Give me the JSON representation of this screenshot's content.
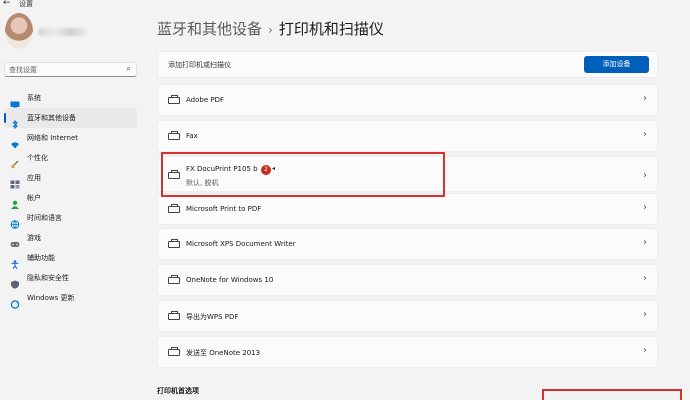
{
  "window": {
    "back_glyph": "←",
    "title": "设置"
  },
  "user": {
    "avatar": "avatar-photo"
  },
  "search": {
    "placeholder": "查找设置",
    "icon": "search-icon"
  },
  "sidebar": {
    "items": [
      {
        "label": "系统",
        "icon": "monitor-icon",
        "color": "#0078d4",
        "active": false
      },
      {
        "label": "蓝牙和其他设备",
        "icon": "bluetooth-icon",
        "color": "#0078d4",
        "active": true
      },
      {
        "label": "网络和 Internet",
        "icon": "wifi-icon",
        "color": "#0078d4",
        "active": false
      },
      {
        "label": "个性化",
        "icon": "brush-icon",
        "color": "#e3a33b",
        "active": false
      },
      {
        "label": "应用",
        "icon": "apps-icon",
        "color": "#5a6b7c",
        "active": false
      },
      {
        "label": "帐户",
        "icon": "account-icon",
        "color": "#2ea043",
        "active": false
      },
      {
        "label": "时间和语言",
        "icon": "globe-icon",
        "color": "#0078d4",
        "active": false
      },
      {
        "label": "游戏",
        "icon": "gamepad-icon",
        "color": "#6b6b6b",
        "active": false
      },
      {
        "label": "辅助功能",
        "icon": "accessibility-icon",
        "color": "#1f6fd1",
        "active": false
      },
      {
        "label": "隐私和安全性",
        "icon": "shield-icon",
        "color": "#5c6670",
        "active": false
      },
      {
        "label": "Windows 更新",
        "icon": "update-icon",
        "color": "#0078d4",
        "active": false
      }
    ]
  },
  "breadcrumb": {
    "parent": "蓝牙和其他设备",
    "separator": "›",
    "current": "打印机和扫描仪"
  },
  "add_device": {
    "label": "添加打印机或扫描仪",
    "button": "添加设备"
  },
  "printers": [
    {
      "name": "Adobe PDF",
      "status": ""
    },
    {
      "name": "Fax",
      "status": ""
    },
    {
      "name": "FX DocuPrint P105 b",
      "status": "默认, 脱机",
      "badge": "2"
    },
    {
      "name": "Microsoft Print to PDF",
      "status": ""
    },
    {
      "name": "Microsoft XPS Document Writer",
      "status": ""
    },
    {
      "name": "OneNote for Windows 10",
      "status": ""
    },
    {
      "name": "导出为WPS PDF",
      "status": ""
    },
    {
      "name": "发送至 OneNote 2013",
      "status": ""
    }
  ],
  "chevron_glyph": "›",
  "section": {
    "printer_preferences": "打印机首选项"
  },
  "colors": {
    "accent": "#005fb8",
    "annotation_red": "#d9302c",
    "badge_red": "#c42b1c"
  }
}
